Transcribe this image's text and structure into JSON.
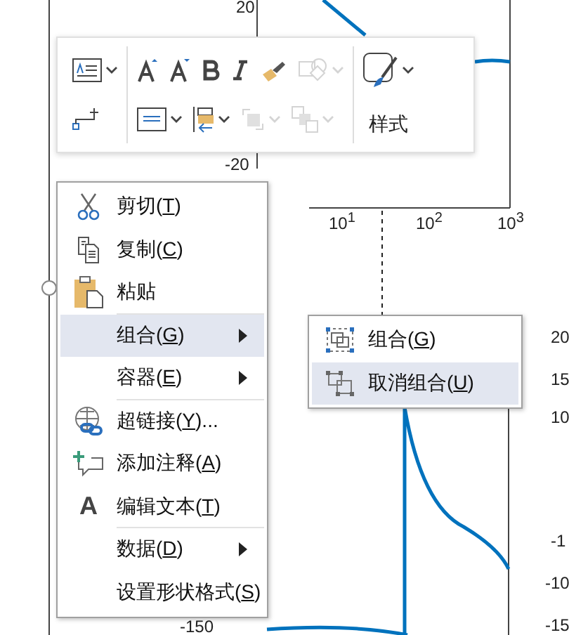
{
  "plot": {
    "tick_labels": [
      "20",
      "-20",
      "10$^{1}$",
      "10$^{2}$",
      "10$^{3}$",
      "-150",
      "20",
      "15",
      "10",
      "-1",
      "-10",
      "-15"
    ]
  },
  "toolbar": {
    "groups": [
      {
        "rows": [
          [
            {
              "kind": "text-box",
              "dropdown": true,
              "disabled": false
            }
          ],
          [
            {
              "kind": "connector",
              "dropdown": false,
              "disabled": false
            }
          ]
        ]
      },
      {
        "rows": [
          [
            {
              "kind": "grow-font",
              "dropdown": false,
              "disabled": false
            },
            {
              "kind": "shrink-font",
              "dropdown": false,
              "disabled": false
            },
            {
              "kind": "bold",
              "dropdown": false,
              "disabled": false
            },
            {
              "kind": "italic",
              "dropdown": false,
              "disabled": false
            },
            {
              "kind": "brush",
              "dropdown": false,
              "disabled": false
            },
            {
              "kind": "shapes",
              "dropdown": true,
              "disabled": true
            }
          ],
          [
            {
              "kind": "align-text",
              "dropdown": true,
              "disabled": false
            },
            {
              "kind": "bring-forward",
              "dropdown": true,
              "disabled": false
            },
            {
              "kind": "send-back",
              "dropdown": true,
              "disabled": true
            },
            {
              "kind": "arrange",
              "dropdown": true,
              "disabled": true
            }
          ]
        ]
      }
    ],
    "style_button": {
      "label": "样式"
    }
  },
  "menu": {
    "items": [
      {
        "kind": "item",
        "parts": [
          "剪切(",
          "T",
          ")"
        ],
        "submenu": false,
        "selected": false
      },
      {
        "kind": "item",
        "parts": [
          "复制(",
          "C",
          ")"
        ],
        "submenu": false,
        "selected": false
      },
      {
        "kind": "item",
        "parts": [
          "粘贴"
        ],
        "submenu": false,
        "selected": false
      },
      {
        "kind": "separator"
      },
      {
        "kind": "item",
        "parts": [
          "组合(",
          "G",
          ")"
        ],
        "submenu": true,
        "selected": true
      },
      {
        "kind": "item",
        "parts": [
          "容器(",
          "E",
          ")"
        ],
        "submenu": true,
        "selected": false
      },
      {
        "kind": "separator"
      },
      {
        "kind": "item",
        "parts": [
          "超链接(",
          "Y",
          ")..."
        ],
        "submenu": false,
        "selected": false
      },
      {
        "kind": "item",
        "parts": [
          "添加注释(",
          "A",
          ")"
        ],
        "submenu": false,
        "selected": false
      },
      {
        "kind": "item",
        "glyph": "A",
        "parts": [
          "编辑文本(",
          "T",
          ")"
        ],
        "submenu": false,
        "selected": false
      },
      {
        "kind": "separator"
      },
      {
        "kind": "item",
        "parts": [
          "数据(",
          "D",
          ")"
        ],
        "submenu": true,
        "selected": false
      },
      {
        "kind": "item",
        "parts": [
          "设置形状格式(",
          "S",
          ")"
        ],
        "submenu": false,
        "selected": false
      }
    ]
  },
  "submenu": {
    "items": [
      {
        "kind": "item",
        "parts": [
          "组合(",
          "G",
          ")"
        ],
        "submenu": false,
        "selected": false
      },
      {
        "kind": "item",
        "parts": [
          "取消组合(",
          "U",
          ")"
        ],
        "submenu": false,
        "selected": true
      }
    ]
  }
}
